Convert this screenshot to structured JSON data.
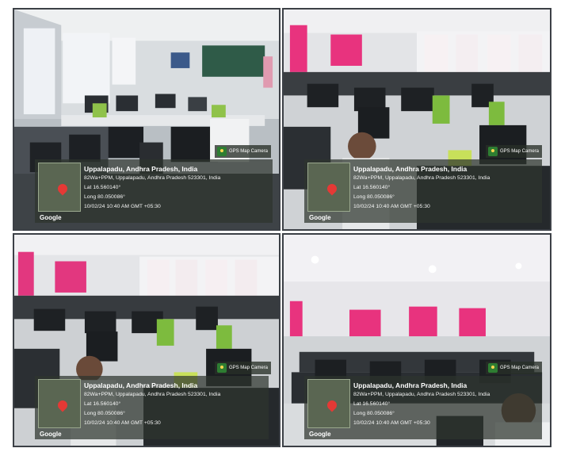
{
  "photos": [
    {
      "stamp": "GPS Map Camera",
      "brand": "Google",
      "location": "Uppalapadu, Andhra Pradesh, India",
      "address": "82Wa+PPM, Uppalapadu, Andhra Pradesh 523301, India",
      "lat": "Lat 16.560140°",
      "long": "Long 80.050086°",
      "datetime": "10/02/24 10:40 AM GMT +05:30"
    },
    {
      "stamp": "GPS Map Camera",
      "brand": "Google",
      "location": "Uppalapadu, Andhra Pradesh, India",
      "address": "82Wa+PPM, Uppalapadu, Andhra Pradesh 523301, India",
      "lat": "Lat 16.560140°",
      "long": "Long 80.050086°",
      "datetime": "10/02/24 10:40 AM GMT +05:30"
    },
    {
      "stamp": "GPS Map Camera",
      "brand": "Google",
      "location": "Uppalapadu, Andhra Pradesh, India",
      "address": "82Wa+PPM, Uppalapadu, Andhra Pradesh 523301, India",
      "lat": "Lat 16.560140°",
      "long": "Long 80.050086°",
      "datetime": "10/02/24 10:40 AM GMT +05:30"
    },
    {
      "stamp": "GPS Map Camera",
      "brand": "Google",
      "location": "Uppalapadu, Andhra Pradesh, India",
      "address": "82Wa+PPM, Uppalapadu, Andhra Pradesh 523301, India",
      "lat": "Lat 16.560140°",
      "long": "Long 80.050086°",
      "datetime": "10/02/24 10:40 AM GMT +05:30"
    }
  ]
}
